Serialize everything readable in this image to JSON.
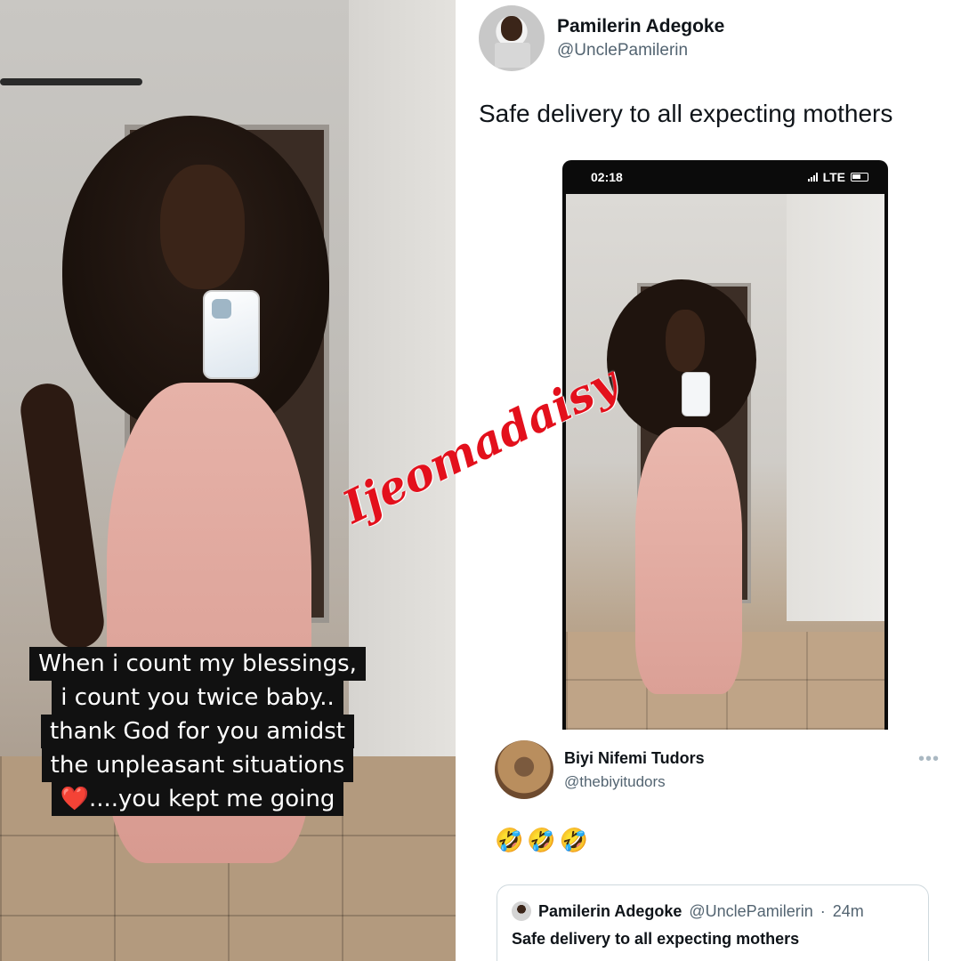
{
  "watermark": "Ijeomadaisy",
  "story": {
    "lines": [
      "When i count my blessings,",
      "i count you twice baby..",
      "thank God for you amidst",
      "the unpleasant situations"
    ],
    "last_line_emoji": "❤️",
    "last_line_text": "....you kept me going"
  },
  "tweet": {
    "author_name": "Pamilerin Adegoke",
    "author_handle": "@UnclePamilerin",
    "text": "Safe delivery to all expecting mothers",
    "screenshot": {
      "time": "02:18",
      "network": "LTE"
    }
  },
  "reply": {
    "author_name": "Biyi Nifemi Tudors",
    "author_handle": "@thebiyitudors",
    "more_icon": "more-horizontal-icon",
    "emojis": "🤣🤣🤣"
  },
  "quote": {
    "author_name": "Pamilerin Adegoke",
    "author_handle": "@UnclePamilerin",
    "separator": "·",
    "time": "24m",
    "text": "Safe delivery to all expecting mothers"
  },
  "colors": {
    "watermark": "#e3101c",
    "heart": "#e0204a",
    "secondary_text": "#536471",
    "card_border": "#cfd9de"
  }
}
